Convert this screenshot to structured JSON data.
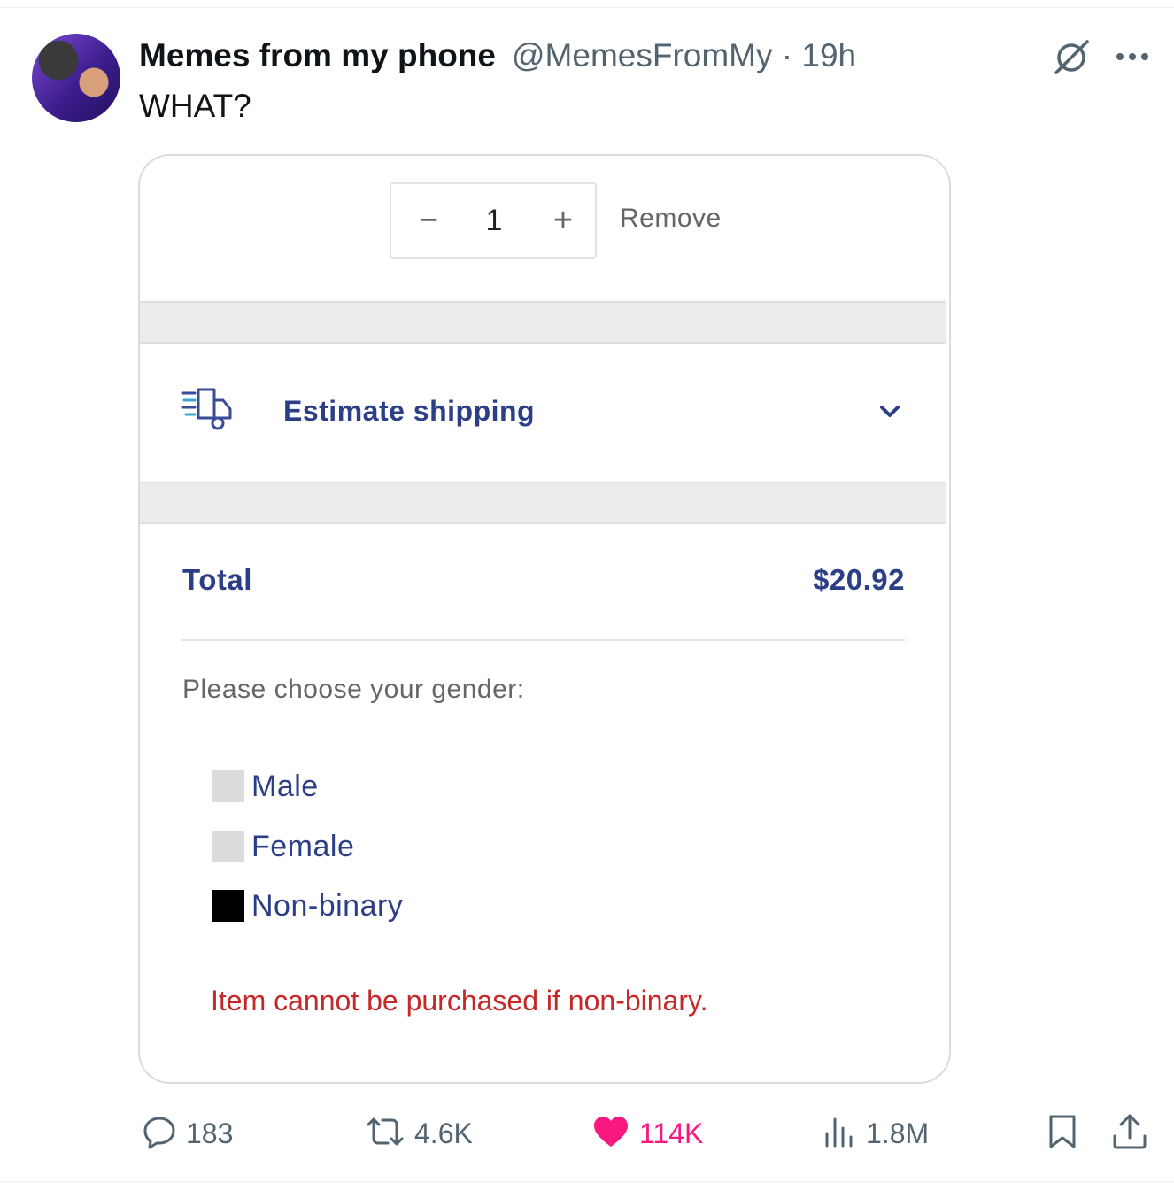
{
  "tweet": {
    "display_name": "Memes from my phone",
    "handle_time": "@MemesFromMy · 19h",
    "text": "WHAT?"
  },
  "icons": {
    "grok": "grok-icon",
    "more": "more-icon",
    "truck": "shipping-truck-icon",
    "chevron": "chevron-down-icon",
    "reply": "reply-icon",
    "retweet": "retweet-icon",
    "like": "heart-icon",
    "views": "views-chart-icon",
    "bookmark": "bookmark-icon",
    "share": "share-icon"
  },
  "cart": {
    "quantity": {
      "minus_label": "−",
      "value": "1",
      "plus_label": "+"
    },
    "remove_label": "Remove",
    "estimate_shipping_label": "Estimate shipping",
    "total_label": "Total",
    "total_value": "$20.92",
    "gender_prompt": "Please choose your gender:",
    "gender_options": [
      {
        "label": "Male",
        "checked": false
      },
      {
        "label": "Female",
        "checked": false
      },
      {
        "label": "Non-binary",
        "checked": true
      }
    ],
    "error_message": "Item cannot be purchased if non-binary."
  },
  "actions": {
    "replies": "183",
    "retweets": "4.6K",
    "likes": "114K",
    "views": "1.8M"
  },
  "colors": {
    "card_text_blue": "#2c3e86",
    "error_red": "#c62828",
    "like_pink": "#f91880",
    "muted_gray": "#536471"
  }
}
